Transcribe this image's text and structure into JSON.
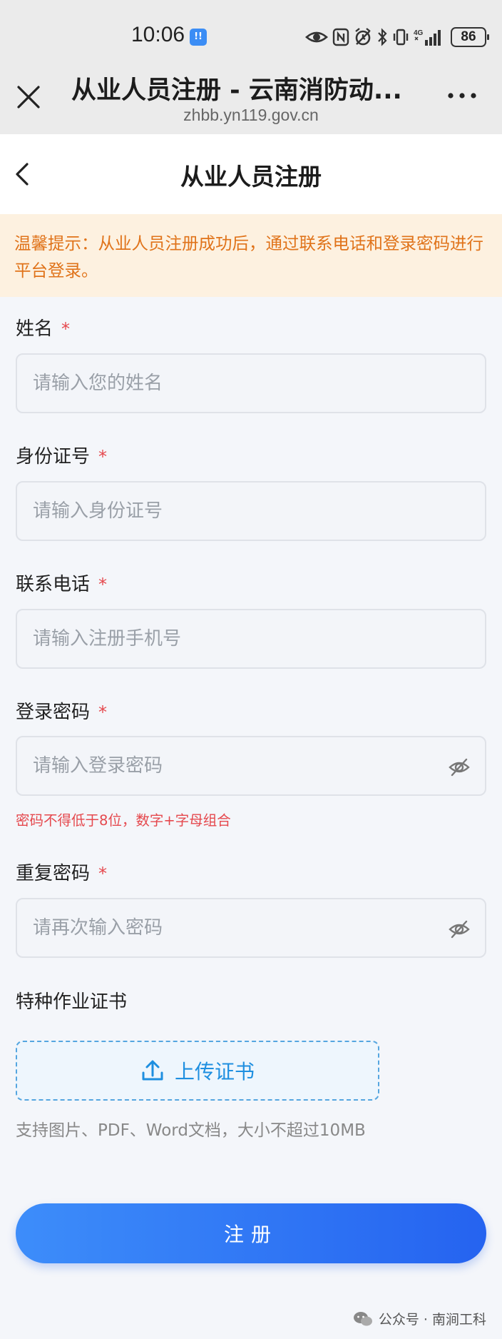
{
  "status_bar": {
    "time": "10:06",
    "time_badge": "!!",
    "battery": "86",
    "network": "4G"
  },
  "browser": {
    "title": "从业人员注册 - 云南消防动...",
    "url": "zhbb.yn119.gov.cn"
  },
  "page": {
    "title": "从业人员注册"
  },
  "notice": {
    "text": "温馨提示：从业人员注册成功后，通过联系电话和登录密码进行平台登录。"
  },
  "form": {
    "required_mark": "*",
    "name": {
      "label": "姓名",
      "placeholder": "请输入您的姓名",
      "value": ""
    },
    "id_number": {
      "label": "身份证号",
      "placeholder": "请输入身份证号",
      "value": ""
    },
    "phone": {
      "label": "联系电话",
      "placeholder": "请输入注册手机号",
      "value": ""
    },
    "password": {
      "label": "登录密码",
      "placeholder": "请输入登录密码",
      "value": "",
      "hint": "密码不得低于8位，数字+字母组合"
    },
    "repeat_password": {
      "label": "重复密码",
      "placeholder": "请再次输入密码",
      "value": ""
    },
    "certificate": {
      "label": "特种作业证书",
      "upload_label": "上传证书",
      "upload_hint": "支持图片、PDF、Word文档，大小不超过10MB"
    },
    "submit_label": "注册"
  },
  "watermark": {
    "text": "公众号 · 南涧工科"
  },
  "colors": {
    "primary": "#2f74f5",
    "warning": "#e0731a",
    "required": "#e5484d",
    "upload": "#1e8fe0"
  }
}
